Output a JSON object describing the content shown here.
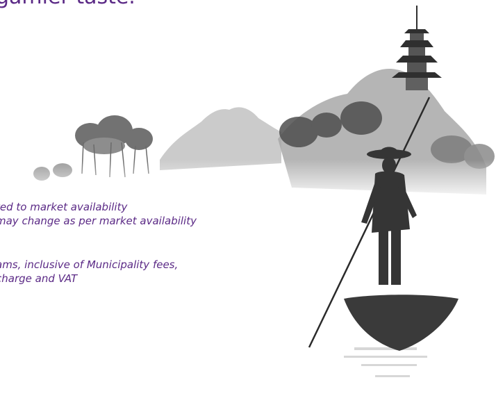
{
  "theme": {
    "text_color": "#5b2a86"
  },
  "headline": {
    "text": "gamier taste."
  },
  "notes": {
    "line1": "ted to market availability",
    "line2": "may change as per market availability",
    "line3": "ams, inclusive of Municipality fees,",
    "line4": " charge and VAT"
  },
  "illustration": {
    "icon": "ink-landscape-boatman-pagoda-icon"
  }
}
